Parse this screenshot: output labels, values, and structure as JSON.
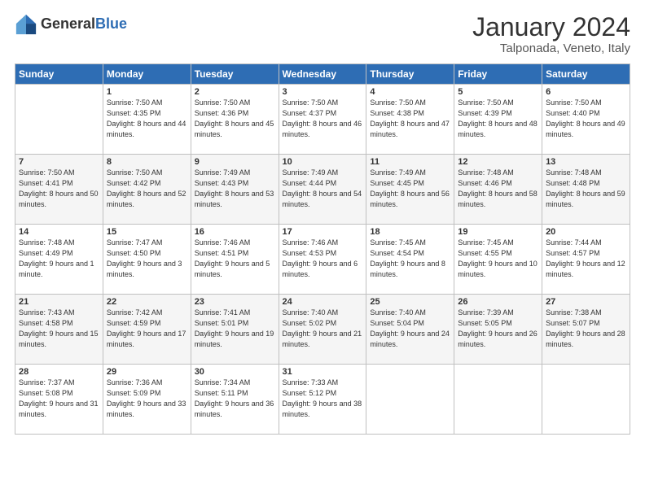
{
  "header": {
    "logo_general": "General",
    "logo_blue": "Blue",
    "month": "January 2024",
    "location": "Talponada, Veneto, Italy"
  },
  "weekdays": [
    "Sunday",
    "Monday",
    "Tuesday",
    "Wednesday",
    "Thursday",
    "Friday",
    "Saturday"
  ],
  "weeks": [
    [
      {
        "day": "",
        "sunrise": "",
        "sunset": "",
        "daylight": ""
      },
      {
        "day": "1",
        "sunrise": "Sunrise: 7:50 AM",
        "sunset": "Sunset: 4:35 PM",
        "daylight": "Daylight: 8 hours and 44 minutes."
      },
      {
        "day": "2",
        "sunrise": "Sunrise: 7:50 AM",
        "sunset": "Sunset: 4:36 PM",
        "daylight": "Daylight: 8 hours and 45 minutes."
      },
      {
        "day": "3",
        "sunrise": "Sunrise: 7:50 AM",
        "sunset": "Sunset: 4:37 PM",
        "daylight": "Daylight: 8 hours and 46 minutes."
      },
      {
        "day": "4",
        "sunrise": "Sunrise: 7:50 AM",
        "sunset": "Sunset: 4:38 PM",
        "daylight": "Daylight: 8 hours and 47 minutes."
      },
      {
        "day": "5",
        "sunrise": "Sunrise: 7:50 AM",
        "sunset": "Sunset: 4:39 PM",
        "daylight": "Daylight: 8 hours and 48 minutes."
      },
      {
        "day": "6",
        "sunrise": "Sunrise: 7:50 AM",
        "sunset": "Sunset: 4:40 PM",
        "daylight": "Daylight: 8 hours and 49 minutes."
      }
    ],
    [
      {
        "day": "7",
        "sunrise": "Sunrise: 7:50 AM",
        "sunset": "Sunset: 4:41 PM",
        "daylight": "Daylight: 8 hours and 50 minutes."
      },
      {
        "day": "8",
        "sunrise": "Sunrise: 7:50 AM",
        "sunset": "Sunset: 4:42 PM",
        "daylight": "Daylight: 8 hours and 52 minutes."
      },
      {
        "day": "9",
        "sunrise": "Sunrise: 7:49 AM",
        "sunset": "Sunset: 4:43 PM",
        "daylight": "Daylight: 8 hours and 53 minutes."
      },
      {
        "day": "10",
        "sunrise": "Sunrise: 7:49 AM",
        "sunset": "Sunset: 4:44 PM",
        "daylight": "Daylight: 8 hours and 54 minutes."
      },
      {
        "day": "11",
        "sunrise": "Sunrise: 7:49 AM",
        "sunset": "Sunset: 4:45 PM",
        "daylight": "Daylight: 8 hours and 56 minutes."
      },
      {
        "day": "12",
        "sunrise": "Sunrise: 7:48 AM",
        "sunset": "Sunset: 4:46 PM",
        "daylight": "Daylight: 8 hours and 58 minutes."
      },
      {
        "day": "13",
        "sunrise": "Sunrise: 7:48 AM",
        "sunset": "Sunset: 4:48 PM",
        "daylight": "Daylight: 8 hours and 59 minutes."
      }
    ],
    [
      {
        "day": "14",
        "sunrise": "Sunrise: 7:48 AM",
        "sunset": "Sunset: 4:49 PM",
        "daylight": "Daylight: 9 hours and 1 minute."
      },
      {
        "day": "15",
        "sunrise": "Sunrise: 7:47 AM",
        "sunset": "Sunset: 4:50 PM",
        "daylight": "Daylight: 9 hours and 3 minutes."
      },
      {
        "day": "16",
        "sunrise": "Sunrise: 7:46 AM",
        "sunset": "Sunset: 4:51 PM",
        "daylight": "Daylight: 9 hours and 5 minutes."
      },
      {
        "day": "17",
        "sunrise": "Sunrise: 7:46 AM",
        "sunset": "Sunset: 4:53 PM",
        "daylight": "Daylight: 9 hours and 6 minutes."
      },
      {
        "day": "18",
        "sunrise": "Sunrise: 7:45 AM",
        "sunset": "Sunset: 4:54 PM",
        "daylight": "Daylight: 9 hours and 8 minutes."
      },
      {
        "day": "19",
        "sunrise": "Sunrise: 7:45 AM",
        "sunset": "Sunset: 4:55 PM",
        "daylight": "Daylight: 9 hours and 10 minutes."
      },
      {
        "day": "20",
        "sunrise": "Sunrise: 7:44 AM",
        "sunset": "Sunset: 4:57 PM",
        "daylight": "Daylight: 9 hours and 12 minutes."
      }
    ],
    [
      {
        "day": "21",
        "sunrise": "Sunrise: 7:43 AM",
        "sunset": "Sunset: 4:58 PM",
        "daylight": "Daylight: 9 hours and 15 minutes."
      },
      {
        "day": "22",
        "sunrise": "Sunrise: 7:42 AM",
        "sunset": "Sunset: 4:59 PM",
        "daylight": "Daylight: 9 hours and 17 minutes."
      },
      {
        "day": "23",
        "sunrise": "Sunrise: 7:41 AM",
        "sunset": "Sunset: 5:01 PM",
        "daylight": "Daylight: 9 hours and 19 minutes."
      },
      {
        "day": "24",
        "sunrise": "Sunrise: 7:40 AM",
        "sunset": "Sunset: 5:02 PM",
        "daylight": "Daylight: 9 hours and 21 minutes."
      },
      {
        "day": "25",
        "sunrise": "Sunrise: 7:40 AM",
        "sunset": "Sunset: 5:04 PM",
        "daylight": "Daylight: 9 hours and 24 minutes."
      },
      {
        "day": "26",
        "sunrise": "Sunrise: 7:39 AM",
        "sunset": "Sunset: 5:05 PM",
        "daylight": "Daylight: 9 hours and 26 minutes."
      },
      {
        "day": "27",
        "sunrise": "Sunrise: 7:38 AM",
        "sunset": "Sunset: 5:07 PM",
        "daylight": "Daylight: 9 hours and 28 minutes."
      }
    ],
    [
      {
        "day": "28",
        "sunrise": "Sunrise: 7:37 AM",
        "sunset": "Sunset: 5:08 PM",
        "daylight": "Daylight: 9 hours and 31 minutes."
      },
      {
        "day": "29",
        "sunrise": "Sunrise: 7:36 AM",
        "sunset": "Sunset: 5:09 PM",
        "daylight": "Daylight: 9 hours and 33 minutes."
      },
      {
        "day": "30",
        "sunrise": "Sunrise: 7:34 AM",
        "sunset": "Sunset: 5:11 PM",
        "daylight": "Daylight: 9 hours and 36 minutes."
      },
      {
        "day": "31",
        "sunrise": "Sunrise: 7:33 AM",
        "sunset": "Sunset: 5:12 PM",
        "daylight": "Daylight: 9 hours and 38 minutes."
      },
      {
        "day": "",
        "sunrise": "",
        "sunset": "",
        "daylight": ""
      },
      {
        "day": "",
        "sunrise": "",
        "sunset": "",
        "daylight": ""
      },
      {
        "day": "",
        "sunrise": "",
        "sunset": "",
        "daylight": ""
      }
    ]
  ]
}
